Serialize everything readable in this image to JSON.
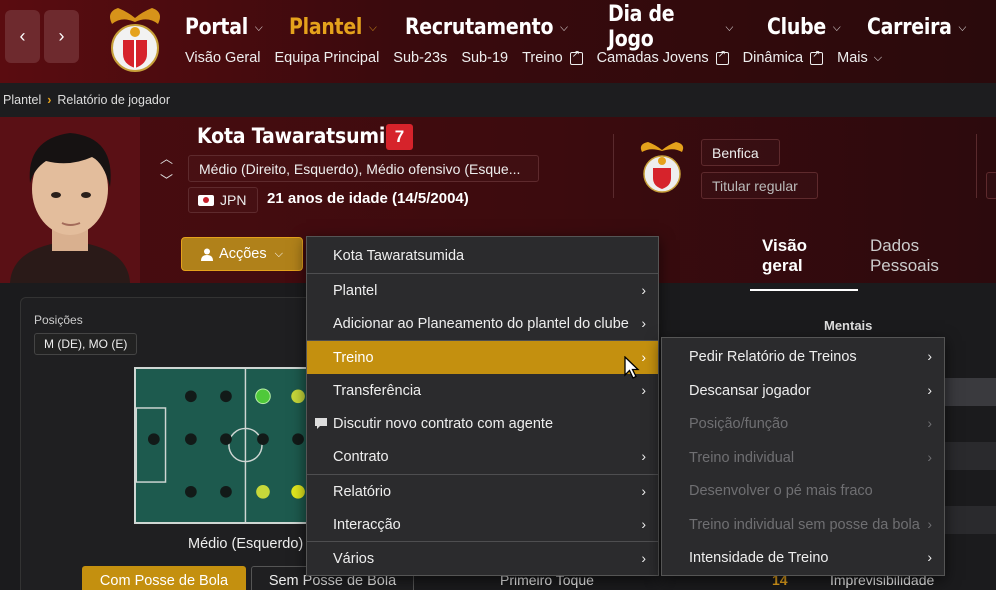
{
  "topnav": {
    "back_icon": "chevron-left-icon",
    "forward_icon": "chevron-right-icon",
    "main": [
      {
        "label": "Portal"
      },
      {
        "label": "Plantel",
        "active": true
      },
      {
        "label": "Recrutamento"
      },
      {
        "label": "Dia de Jogo"
      },
      {
        "label": "Clube"
      },
      {
        "label": "Carreira"
      }
    ],
    "sub": [
      {
        "label": "Visão Geral"
      },
      {
        "label": "Equipa Principal"
      },
      {
        "label": "Sub-23s"
      },
      {
        "label": "Sub-19"
      },
      {
        "label": "Treino",
        "external": true
      },
      {
        "label": "Camadas Jovens",
        "external": true
      },
      {
        "label": "Dinâmica",
        "external": true
      },
      {
        "label": "Mais"
      }
    ]
  },
  "breadcrumb": {
    "root": "Plantel",
    "current": "Relatório de jogador"
  },
  "player": {
    "name": "Kota Tawaratsumida",
    "number": "7",
    "positions": "Médio (Direito, Esquerdo), Médio ofensivo (Esque...",
    "nationality": "JPN",
    "age": "21 anos de idade (14/5/2004)",
    "club": "Benfica",
    "status": "Titular regular"
  },
  "actions_label": "Acções",
  "tabs": [
    {
      "label": "Visão geral",
      "active": true
    },
    {
      "label": "Dados Pessoais"
    }
  ],
  "positions_panel": {
    "title": "Posições",
    "chip": "M (DE), MO (E)",
    "pitch_label": "Médio (Esquerdo)",
    "btn_in_possession": "Com Posse de Bola",
    "btn_out_possession": "Sem Posse de Bola"
  },
  "attributes": {
    "mental_header": "Mentais",
    "row_label": "Primeiro Toque",
    "row_value": "14",
    "mental_row": "Imprevisibilidade"
  },
  "context_menu": {
    "header": "Kota Tawaratsumida",
    "items": [
      {
        "label": "Plantel",
        "submenu": true
      },
      {
        "label": "Adicionar ao Planeamento do plantel do clube",
        "submenu": true
      },
      {
        "label": "Treino",
        "submenu": true,
        "highlighted": true
      },
      {
        "label": "Transferência",
        "submenu": true
      },
      {
        "label": "Discutir novo contrato com agente",
        "icon": "chat-icon"
      },
      {
        "label": "Contrato",
        "submenu": true
      },
      {
        "label": "Relatório",
        "submenu": true
      },
      {
        "label": "Interacção",
        "submenu": true
      },
      {
        "label": "Vários",
        "submenu": true
      }
    ]
  },
  "training_submenu": {
    "items": [
      {
        "label": "Pedir Relatório de Treinos",
        "submenu": true,
        "enabled": true
      },
      {
        "label": "Descansar jogador",
        "submenu": true,
        "enabled": true
      },
      {
        "label": "Posição/função",
        "submenu": true,
        "enabled": false
      },
      {
        "label": "Treino individual",
        "submenu": true,
        "enabled": false
      },
      {
        "label": "Desenvolver o pé mais fraco",
        "submenu": false,
        "enabled": false
      },
      {
        "label": "Treino individual sem posse da bola",
        "submenu": true,
        "enabled": false
      },
      {
        "label": "Intensidade de Treino",
        "submenu": true,
        "enabled": true
      }
    ]
  },
  "colors": {
    "accent": "#e5a21c",
    "highlight": "#c4900f",
    "number_badge": "#d6232b",
    "header_bg": "#4a0c10"
  }
}
